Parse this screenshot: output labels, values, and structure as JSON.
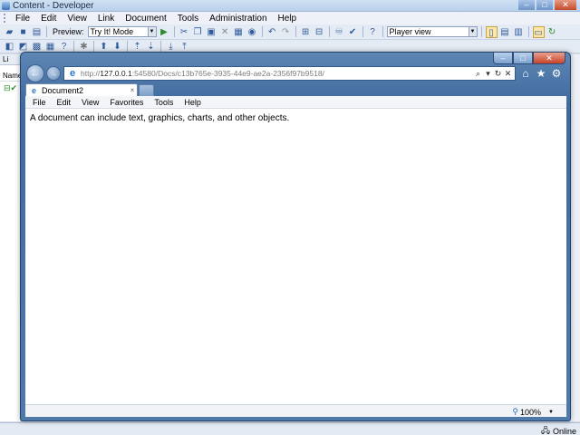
{
  "app": {
    "title": "Content - Developer",
    "menu": [
      "File",
      "Edit",
      "View",
      "Link",
      "Document",
      "Tools",
      "Administration",
      "Help"
    ],
    "toolbar": {
      "preview_label": "Preview:",
      "mode_value": "Try It! Mode",
      "view_value": "Player view"
    },
    "left_panel": {
      "header": "Li",
      "column": "Name"
    },
    "status": {
      "text": "Online"
    },
    "window_buttons": {
      "minimize": "–",
      "maximize": "□",
      "close": "✕"
    }
  },
  "browser": {
    "window_buttons": {
      "minimize": "–",
      "maximize": "□",
      "close": "✕"
    },
    "nav": {
      "back": "←",
      "forward": "→"
    },
    "address": {
      "scheme": "http://",
      "host": "127.0.0.1",
      "rest": ":54580/Docs/c13b765e-3935-44e9-ae2a-2356f97b9518/"
    },
    "tab": {
      "label": "Document2",
      "close": "×"
    },
    "menu": [
      "File",
      "Edit",
      "View",
      "Favorites",
      "Tools",
      "Help"
    ],
    "content": {
      "text": "A document can include text, graphics, charts, and other objects."
    },
    "status": {
      "zoom": "100%"
    }
  },
  "icons": {
    "ie_logo": "e",
    "search": "⌕",
    "refresh": "↻",
    "stop": "✕",
    "home": "⌂",
    "favorites": "★",
    "settings": "⚙",
    "zoom": "⚲"
  }
}
